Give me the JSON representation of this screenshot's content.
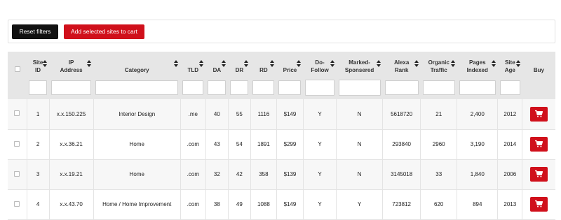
{
  "toolbar": {
    "reset_label": "Reset filters",
    "add_label": "Add selected sites to cart"
  },
  "table": {
    "headers": [
      {
        "lines": [
          "",
          ""
        ],
        "sortable": false
      },
      {
        "lines": [
          "Site",
          "ID"
        ],
        "sortable": true
      },
      {
        "lines": [
          "IP",
          "Address"
        ],
        "sortable": true
      },
      {
        "lines": [
          "Category",
          ""
        ],
        "sortable": true
      },
      {
        "lines": [
          "TLD",
          ""
        ],
        "sortable": true
      },
      {
        "lines": [
          "DA",
          ""
        ],
        "sortable": true
      },
      {
        "lines": [
          "DR",
          ""
        ],
        "sortable": true
      },
      {
        "lines": [
          "RD",
          ""
        ],
        "sortable": true
      },
      {
        "lines": [
          "Price",
          ""
        ],
        "sortable": true
      },
      {
        "lines": [
          "Do-",
          "Follow"
        ],
        "sortable": true
      },
      {
        "lines": [
          "Marked-",
          "Sponsered"
        ],
        "sortable": true
      },
      {
        "lines": [
          "Alexa",
          "Rank"
        ],
        "sortable": true
      },
      {
        "lines": [
          "Organic",
          "Traffic"
        ],
        "sortable": true
      },
      {
        "lines": [
          "Pages",
          "Indexed"
        ],
        "sortable": true
      },
      {
        "lines": [
          "Site",
          "Age"
        ],
        "sortable": true
      },
      {
        "lines": [
          "Buy",
          ""
        ],
        "sortable": false
      }
    ],
    "rows": [
      {
        "site_id": "1",
        "ip": "x.x.150.225",
        "category": "Interior Design",
        "tld": ".me",
        "da": "40",
        "dr": "55",
        "rd": "1116",
        "price": "$149",
        "dofollow": "Y",
        "sponsored": "N",
        "alexa": "5618720",
        "traffic": "21",
        "pages": "2,400",
        "age": "2012"
      },
      {
        "site_id": "2",
        "ip": "x.x.36.21",
        "category": "Home",
        "tld": ".com",
        "da": "43",
        "dr": "54",
        "rd": "1891",
        "price": "$299",
        "dofollow": "Y",
        "sponsored": "N",
        "alexa": "293840",
        "traffic": "2960",
        "pages": "3,190",
        "age": "2014"
      },
      {
        "site_id": "3",
        "ip": "x.x.19.21",
        "category": "Home",
        "tld": ".com",
        "da": "32",
        "dr": "42",
        "rd": "358",
        "price": "$139",
        "dofollow": "Y",
        "sponsored": "N",
        "alexa": "3145018",
        "traffic": "33",
        "pages": "1,840",
        "age": "2006"
      },
      {
        "site_id": "4",
        "ip": "x.x.43.70",
        "category": "Home / Home Improvement",
        "tld": ".com",
        "da": "38",
        "dr": "49",
        "rd": "1088",
        "price": "$149",
        "dofollow": "Y",
        "sponsored": "Y",
        "alexa": "723812",
        "traffic": "620",
        "pages": "894",
        "age": "2013"
      }
    ]
  },
  "icons": {
    "cart": "cart-icon",
    "sort": "sort-icon"
  },
  "colors": {
    "accent": "#d0101b",
    "dark_button": "#111111",
    "header_bg": "#e6e6e6"
  }
}
